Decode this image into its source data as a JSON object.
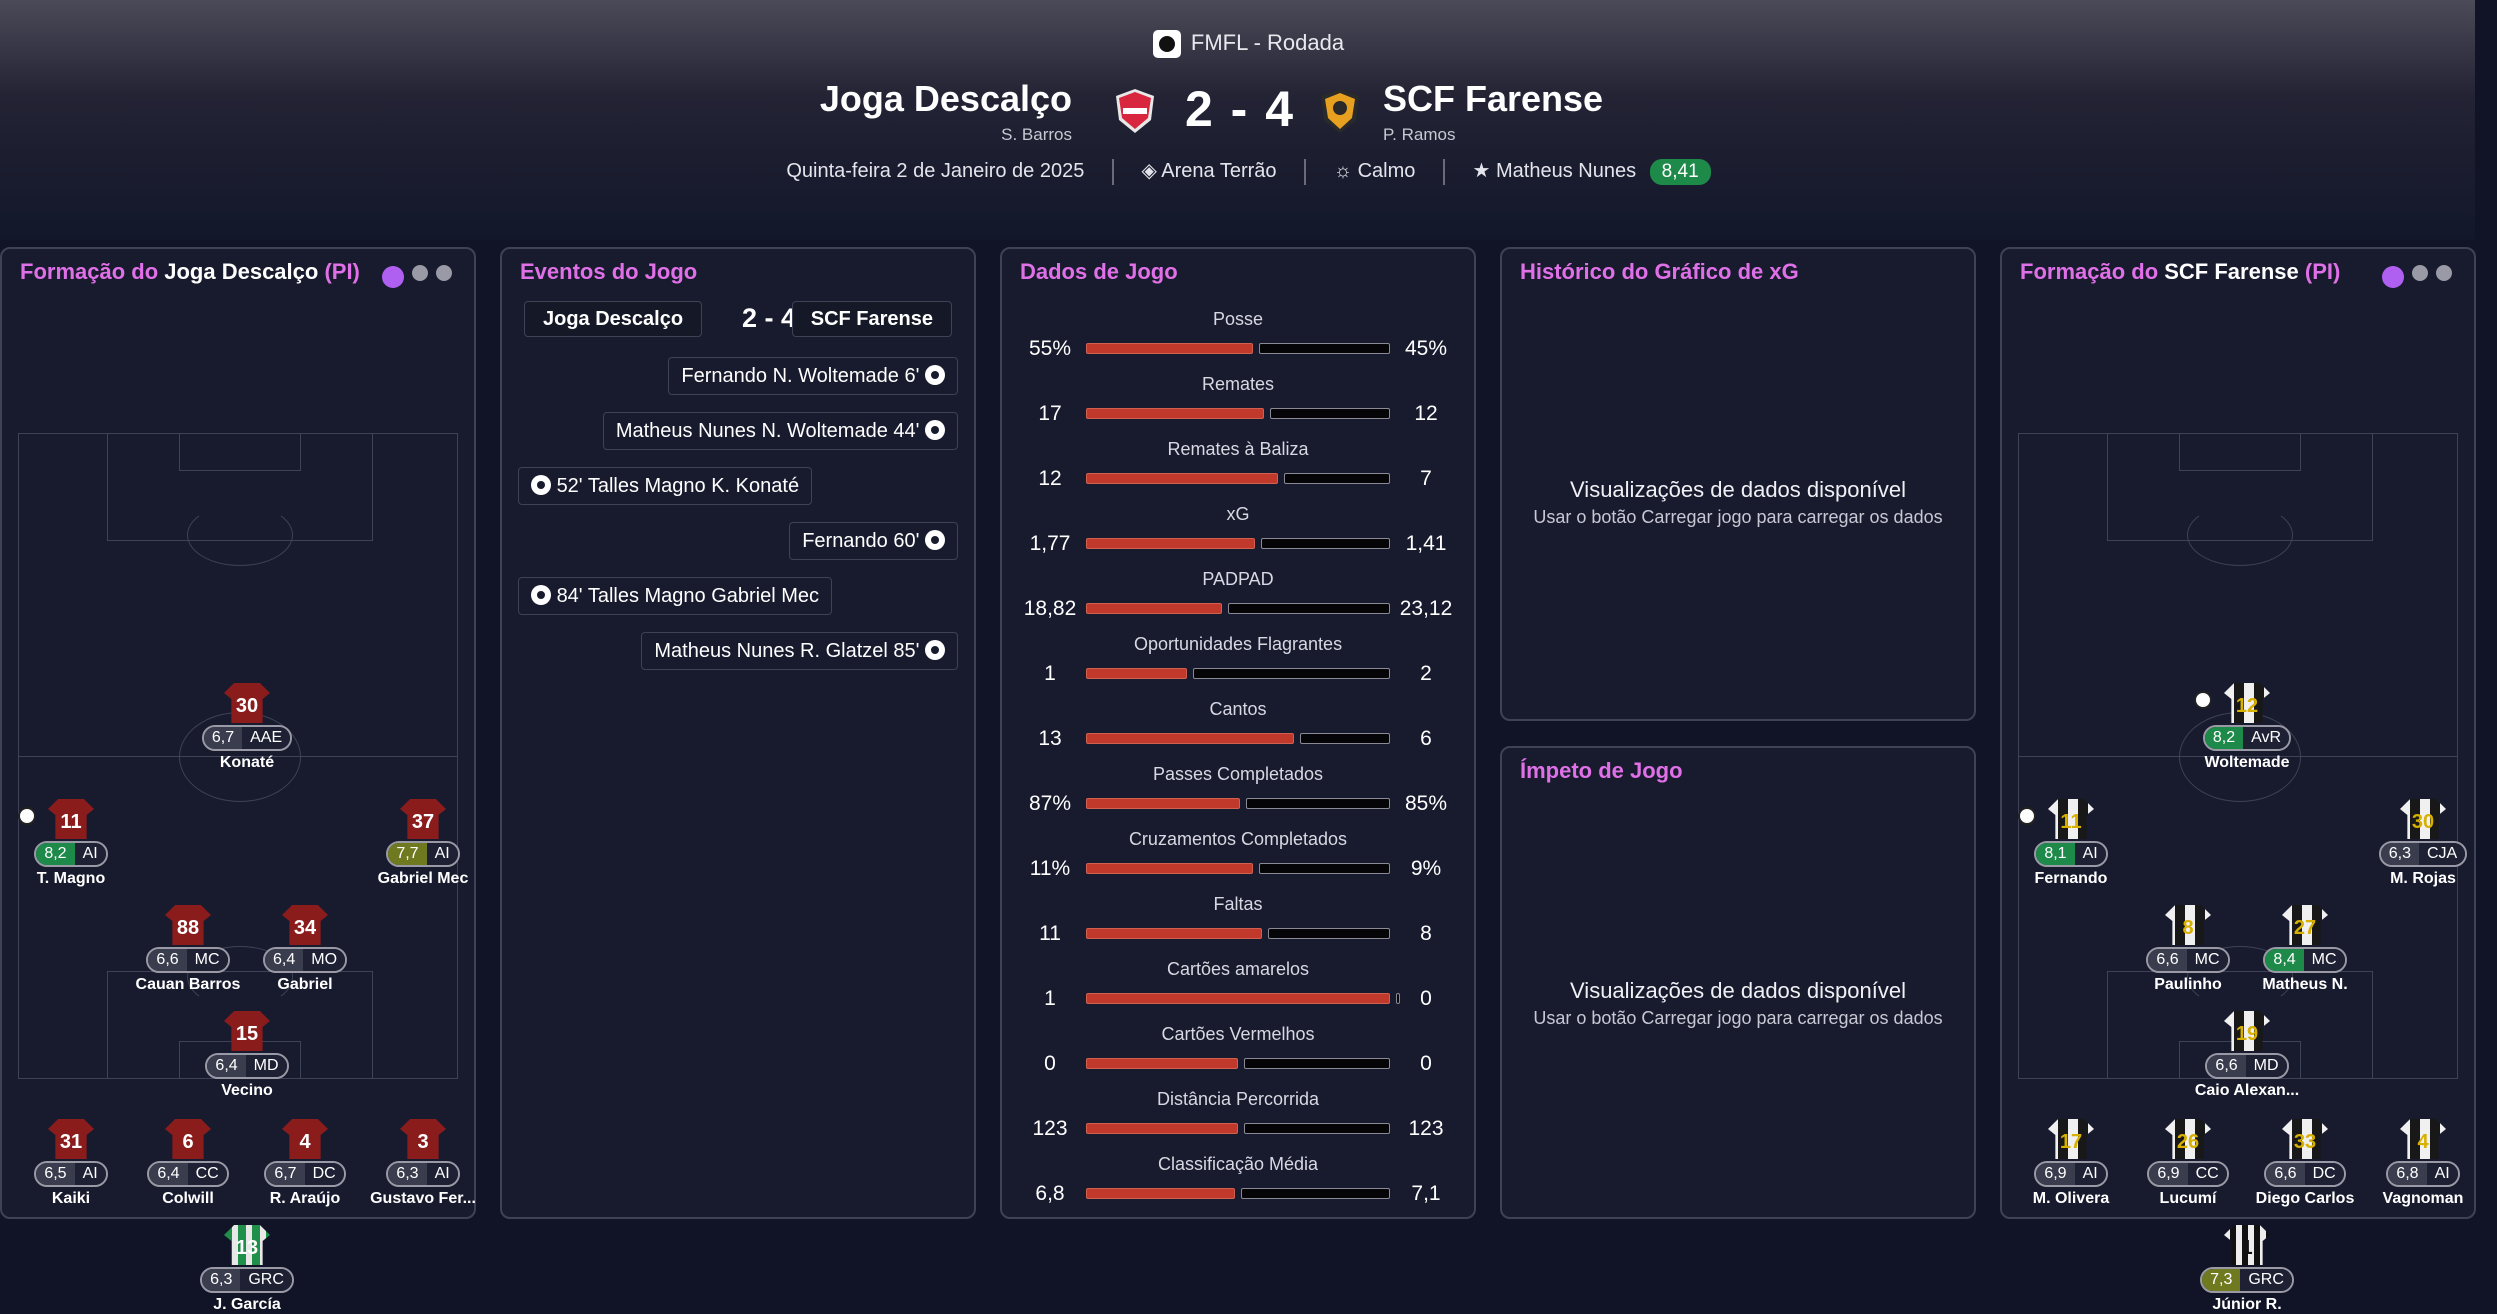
{
  "competition": "FMFL - Rodada",
  "home": {
    "name": "Joga Descalço",
    "manager": "S. Barros"
  },
  "away": {
    "name": "SCF Farense",
    "manager": "P. Ramos"
  },
  "score": "2 - 4",
  "info": {
    "date": "Quinta-feira 2 de Janeiro de 2025",
    "stadium": "Arena Terrão",
    "weather": "Calmo",
    "motm_name": "Matheus Nunes",
    "motm_rating": "8,41"
  },
  "home_lineup": {
    "title_prefix": "Formação do ",
    "team": "Joga Descalço",
    "suffix": " (PI)",
    "players": [
      {
        "num": "30",
        "rating": "6,7",
        "pos": "AAE",
        "name": "Konaté",
        "rc": ""
      },
      {
        "num": "11",
        "rating": "8,2",
        "pos": "AI",
        "name": "T. Magno",
        "rc": "green"
      },
      {
        "num": "37",
        "rating": "7,7",
        "pos": "AI",
        "name": "Gabriel Mec",
        "rc": "olive"
      },
      {
        "num": "88",
        "rating": "6,6",
        "pos": "MC",
        "name": "Cauan Barros",
        "rc": ""
      },
      {
        "num": "34",
        "rating": "6,4",
        "pos": "MO",
        "name": "Gabriel",
        "rc": ""
      },
      {
        "num": "15",
        "rating": "6,4",
        "pos": "MD",
        "name": "Vecino",
        "rc": ""
      },
      {
        "num": "31",
        "rating": "6,5",
        "pos": "AI",
        "name": "Kaiki",
        "rc": ""
      },
      {
        "num": "6",
        "rating": "6,4",
        "pos": "CC",
        "name": "Colwill",
        "rc": ""
      },
      {
        "num": "4",
        "rating": "6,7",
        "pos": "DC",
        "name": "R. Araújo",
        "rc": ""
      },
      {
        "num": "3",
        "rating": "6,3",
        "pos": "AI",
        "name": "Gustavo Fer...",
        "rc": ""
      },
      {
        "num": "13",
        "rating": "6,3",
        "pos": "GRC",
        "name": "J. García",
        "rc": ""
      }
    ]
  },
  "away_lineup": {
    "title_prefix": "Formação do ",
    "team": "SCF Farense",
    "suffix": " (PI)",
    "players": [
      {
        "num": "12",
        "rating": "8,2",
        "pos": "AvR",
        "name": "Woltemade",
        "rc": "green"
      },
      {
        "num": "11",
        "rating": "8,1",
        "pos": "AI",
        "name": "Fernando",
        "rc": "green"
      },
      {
        "num": "30",
        "rating": "6,3",
        "pos": "CJA",
        "name": "M. Rojas",
        "rc": ""
      },
      {
        "num": "8",
        "rating": "6,6",
        "pos": "MC",
        "name": "Paulinho",
        "rc": ""
      },
      {
        "num": "27",
        "rating": "8,4",
        "pos": "MC",
        "name": "Matheus N.",
        "rc": "green"
      },
      {
        "num": "19",
        "rating": "6,6",
        "pos": "MD",
        "name": "Caio Alexan...",
        "rc": ""
      },
      {
        "num": "17",
        "rating": "6,9",
        "pos": "AI",
        "name": "M. Olivera",
        "rc": ""
      },
      {
        "num": "26",
        "rating": "6,9",
        "pos": "CC",
        "name": "Lucumí",
        "rc": ""
      },
      {
        "num": "33",
        "rating": "6,6",
        "pos": "DC",
        "name": "Diego Carlos",
        "rc": ""
      },
      {
        "num": "4",
        "rating": "6,8",
        "pos": "AI",
        "name": "Vagnoman",
        "rc": ""
      },
      {
        "num": "1",
        "rating": "7,3",
        "pos": "GRC",
        "name": "Júnior R.",
        "rc": "olive"
      }
    ]
  },
  "events_panel": {
    "title": "Eventos do Jogo",
    "events": [
      {
        "text": "Fernando  N. Woltemade  6'",
        "side": "right"
      },
      {
        "text": "Matheus Nunes  N. Woltemade  44'",
        "side": "right"
      },
      {
        "text": "52'  Talles Magno  K. Konaté",
        "side": "left"
      },
      {
        "text": "Fernando  60'",
        "side": "right"
      },
      {
        "text": "84'  Talles Magno  Gabriel Mec",
        "side": "left"
      },
      {
        "text": "Matheus Nunes  R. Glatzel  85'",
        "side": "right"
      }
    ]
  },
  "stats_panel": {
    "title": "Dados de Jogo",
    "stats": [
      {
        "label": "Posse",
        "home": "55%",
        "away": "45%",
        "h": 55,
        "a": 45
      },
      {
        "label": "Remates",
        "home": "17",
        "away": "12",
        "h": 17,
        "a": 12
      },
      {
        "label": "Remates à Baliza",
        "home": "12",
        "away": "7",
        "h": 12,
        "a": 7
      },
      {
        "label": "xG",
        "home": "1,77",
        "away": "1,41",
        "h": 1.77,
        "a": 1.41
      },
      {
        "label": "PADPAD",
        "home": "18,82",
        "away": "23,12",
        "h": 18.82,
        "a": 23.12
      },
      {
        "label": "Oportunidades Flagrantes",
        "home": "1",
        "away": "2",
        "h": 1,
        "a": 2
      },
      {
        "label": "Cantos",
        "home": "13",
        "away": "6",
        "h": 13,
        "a": 6
      },
      {
        "label": "Passes Completados",
        "home": "87%",
        "away": "85%",
        "h": 87,
        "a": 85
      },
      {
        "label": "Cruzamentos Completados",
        "home": "11%",
        "away": "9%",
        "h": 11,
        "a": 9
      },
      {
        "label": "Faltas",
        "home": "11",
        "away": "8",
        "h": 11,
        "a": 8
      },
      {
        "label": "Cartões amarelos",
        "home": "1",
        "away": "0",
        "h": 1,
        "a": 0
      },
      {
        "label": "Cartões Vermelhos",
        "home": "0",
        "away": "0",
        "h": 0,
        "a": 0
      },
      {
        "label": "Distância Percorrida",
        "home": "123",
        "away": "123",
        "h": 123,
        "a": 123
      },
      {
        "label": "Classificação Média",
        "home": "6,8",
        "away": "7,1",
        "h": 6.8,
        "a": 7.1
      }
    ]
  },
  "xg_panel": {
    "title": "Histórico do Gráfico de xG",
    "msg1": "Visualizações de dados disponível",
    "msg2": "Usar o botão Carregar jogo para carregar os dados"
  },
  "momentum_panel": {
    "title": "Ímpeto de Jogo",
    "msg1": "Visualizações de dados disponível",
    "msg2": "Usar o botão Carregar jogo para carregar os dados"
  },
  "colors": {
    "accent": "#e070e8",
    "home_bar": "#c0392b",
    "rating_green": "#1e8a4a",
    "rating_olive": "#6f7a20"
  }
}
